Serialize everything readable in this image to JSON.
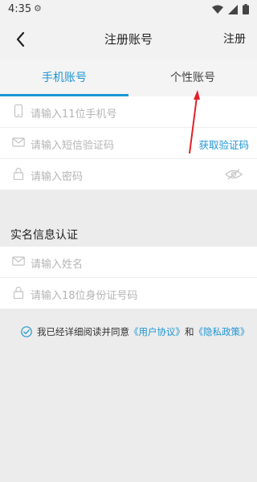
{
  "status_bar": {
    "time": "4:35"
  },
  "nav": {
    "title": "注册账号",
    "register_label": "注册"
  },
  "tabs": [
    {
      "label": "手机账号"
    },
    {
      "label": "个性账号"
    }
  ],
  "phone_form": {
    "phone_placeholder": "请输入11位手机号",
    "sms_placeholder": "请输入短信验证码",
    "get_code_label": "获取验证码",
    "password_placeholder": "请输入密码"
  },
  "realname": {
    "section_title": "实名信息认证",
    "name_placeholder": "请输入姓名",
    "id_placeholder": "请输入18位身份证号码"
  },
  "agreement": {
    "prefix": "我已经详细阅读并同意",
    "user_agreement": "《用户协议》",
    "and": "和",
    "privacy_policy": "《隐私政策》"
  },
  "colors": {
    "accent": "#1e96d6",
    "annotation_arrow": "#e2202a"
  }
}
